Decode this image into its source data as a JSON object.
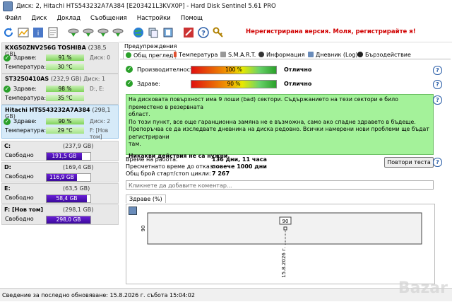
{
  "window": {
    "title": "Диск: 2, Hitachi HTS543232A7A384 [E203421L3KVX0P]  -  Hard Disk Sentinel 5.61 PRO"
  },
  "menu": [
    "Файл",
    "Диск",
    "Доклад",
    "Съобщения",
    "Настройки",
    "Помощ"
  ],
  "toolbar": {
    "icons": [
      "refresh-icon",
      "chart-icon",
      "info-icon",
      "report-icon",
      "drive-icon",
      "drive-icon",
      "drive-icon",
      "drive-icon",
      "globe-icon",
      "copy-icon",
      "paste-icon",
      "tools-icon",
      "help-icon",
      "key-icon"
    ],
    "registration": "Нерегистрирана версия. Моля, регистрирайте я!"
  },
  "disks": [
    {
      "name": "KXG50ZNV256G TOSHIBA",
      "capacity": "(238,5 GB)",
      "health_label": "Здраве:",
      "health": "91 %",
      "temp_label": "Температура:",
      "temp": "30 °C",
      "letters": "Диск: 0",
      "health_pct": 91
    },
    {
      "name": "ST3250410AS",
      "capacity": "(232,9 GB)",
      "disk_no": "Диск: 1",
      "health_label": "Здраве:",
      "health": "98 %",
      "temp_label": "Температура:",
      "temp": "35 °C",
      "letters": "D:, E:",
      "health_pct": 98
    },
    {
      "name": "Hitachi HTS543232A7A384",
      "capacity": "(298,1 GB)",
      "health_label": "Здраве:",
      "health": "90 %",
      "temp_label": "Температура:",
      "temp": "29 °C",
      "letters": "Диск: 2",
      "letters2": "F: [Нов том]",
      "health_pct": 90
    }
  ],
  "volumes": [
    {
      "name": "C:",
      "capacity": "(237,9 GB)",
      "free_label": "Свободно",
      "free": "191,5 GB",
      "free_pct": 80
    },
    {
      "name": "D:",
      "capacity": "(169,4 GB)",
      "free_label": "Свободно",
      "free": "116,9 GB",
      "free_pct": 69
    },
    {
      "name": "E:",
      "capacity": "(63,5 GB)",
      "free_label": "Свободно",
      "free": "58,4 GB",
      "free_pct": 92
    },
    {
      "name": "F: [Нов том]",
      "capacity": "(298,1 GB)",
      "free_label": "Свободно",
      "free": "298,0 GB",
      "free_pct": 100
    }
  ],
  "tabs": {
    "top": "Предупреждения",
    "items": [
      "Общ преглед",
      "Температура",
      "S.M.A.R.T.",
      "Информация",
      "Дневник (Log)",
      "Бързодействие"
    ]
  },
  "overview": {
    "performance_label": "Производителност:",
    "performance": "100 %",
    "performance_status": "Отлично",
    "health_label": "Здраве:",
    "health": "90 %",
    "health_status": "Отлично",
    "message_lines": [
      "На дисковата повърхност има 9 лоши (bad) сектори. Съдържанието на тези сектори е било преместено в резервната",
      "област.",
      "По този пункт, все още гаранционна замяна не е възможна, само ако спадне здравето в бъдеще.",
      "Препоръчва се да изследвате дневника на диска редовно. Всички намерени нови проблеми ще бъдат регистрирани",
      "там."
    ],
    "message_action": "Никакви действия не са нужни.",
    "runtime_label": "Време на работа:",
    "runtime": "136 дни, 11 часа",
    "remaining_label": "Пресметнато време до отказ:",
    "remaining": "повече 1000 дни",
    "starts_label": "Общ брой старт/стоп цикли:",
    "starts": "7 267",
    "retest_button": "Повтори теста",
    "comment_placeholder": "Кликнете да добавите коментар...",
    "health_tab": "Здраве (%)"
  },
  "chart_data": {
    "type": "line",
    "title": "",
    "x": [
      "15.8.2026 г."
    ],
    "series": [
      {
        "values": [
          90
        ]
      }
    ],
    "ytick": "90"
  },
  "status": "Сведение за последно обновяване: 15.8.2026 г. събота 15:04:02",
  "watermark": "Bazar"
}
